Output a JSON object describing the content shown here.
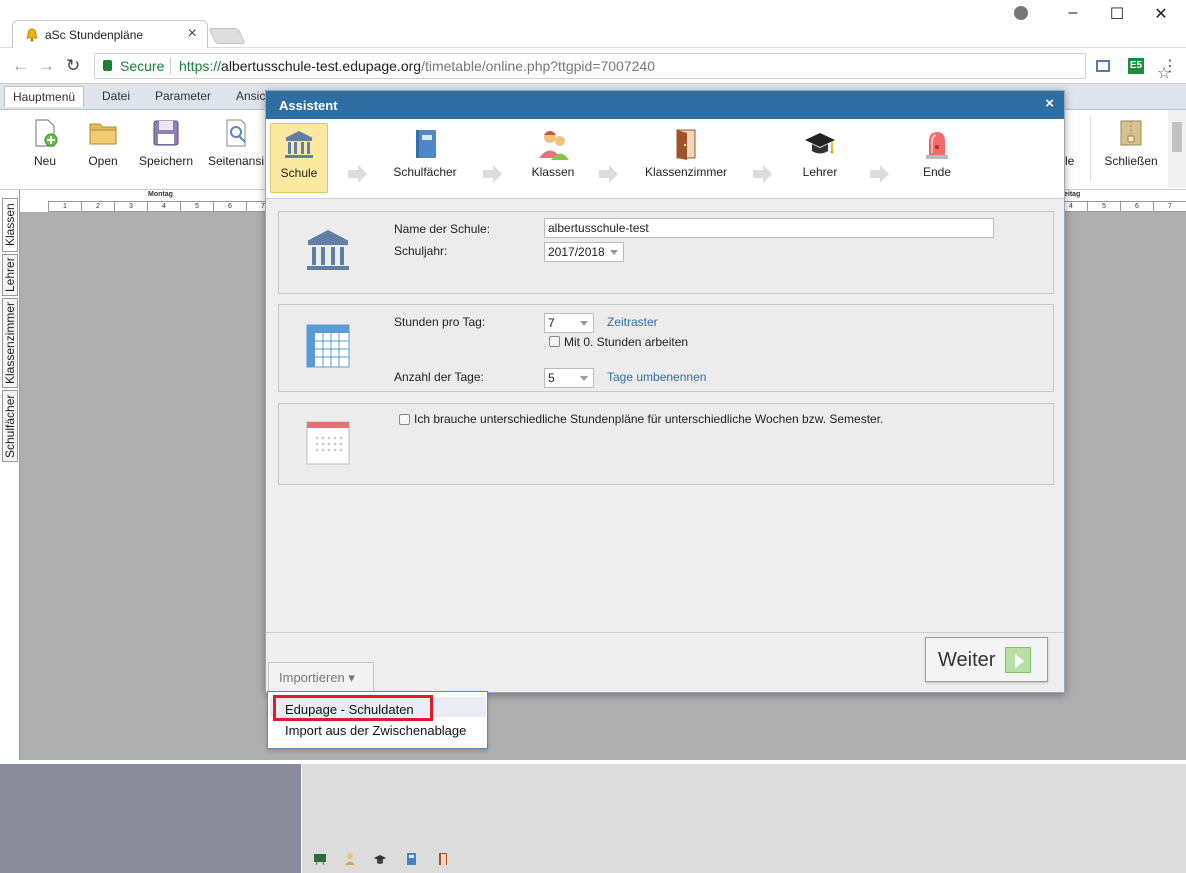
{
  "browser": {
    "tab_title": "aSc Stundenpläne",
    "secure_label": "Secure",
    "url_scheme": "https://",
    "url_host": "albertusschule-test.edupage.org",
    "url_path": "/timetable/online.php?ttgpid=7007240",
    "extension_badge": "E5"
  },
  "ribbon": {
    "tabs": [
      "Hauptmenü",
      "Datei",
      "Parameter",
      "Ansic"
    ],
    "buttons": [
      "Neu",
      "Open",
      "Speichern",
      "Seitenansi"
    ],
    "right_partial_label": "le",
    "close_label": "Schließen"
  },
  "grid": {
    "day_left": "Montag",
    "day_right": "eitag",
    "periods_left": [
      "1",
      "2",
      "3",
      "4",
      "5",
      "6",
      "7"
    ],
    "periods_right": [
      "4",
      "5",
      "6",
      "7"
    ]
  },
  "side_tabs": [
    "Klassen",
    "Lehrer",
    "Klassenzimmer",
    "Schulfächer"
  ],
  "modal": {
    "title": "Assistent",
    "close_symbol": "×",
    "steps": [
      "Schule",
      "Schulfächer",
      "Klassen",
      "Klassenzimmer",
      "Lehrer",
      "Ende"
    ],
    "school_name_label": "Name der Schule:",
    "school_name_value": "albertusschule-test",
    "school_year_label": "Schuljahr:",
    "school_year_value": "2017/2018",
    "lessons_per_day_label": "Stunden pro Tag:",
    "lessons_per_day_value": "7",
    "zeitraster_link": "Zeitraster",
    "zero_lessons_label": "Mit 0. Stunden arbeiten",
    "days_count_label": "Anzahl der Tage:",
    "days_count_value": "5",
    "rename_days_link": "Tage umbenennen",
    "multi_week_label": "Ich brauche unterschiedliche Stundenpläne für unterschiedliche Wochen bzw. Semester.",
    "import_button": "Importieren ▾",
    "next_button": "Weiter"
  },
  "import_menu": {
    "items": [
      "Edupage - Schuldaten",
      "Import aus der Zwischenablage"
    ]
  },
  "colors": {
    "header_blue": "#2f6ea3",
    "highlight_red": "#e11c2a",
    "active_step": "#fbe9a2"
  }
}
